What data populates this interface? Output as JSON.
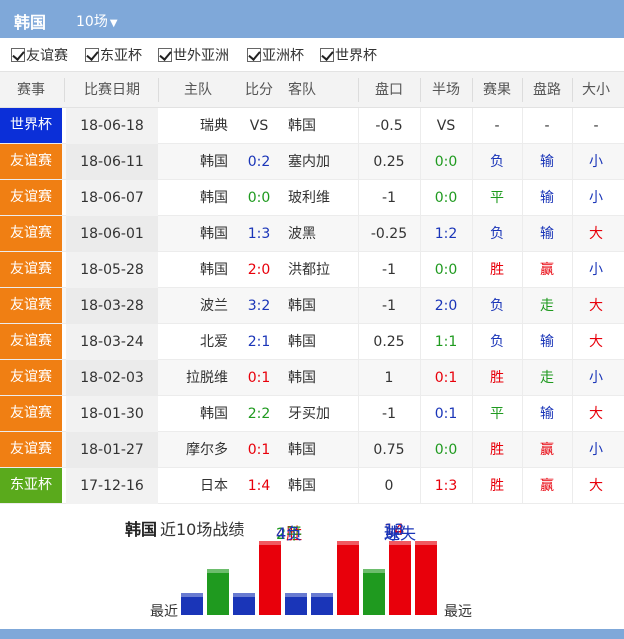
{
  "header": {
    "team": "韩国",
    "count_label": "10场"
  },
  "filters": [
    "友谊赛",
    "东亚杯",
    "世外亚洲",
    "亚洲杯",
    "世界杯"
  ],
  "columns": [
    "赛事",
    "比赛日期",
    "主队",
    "比分",
    "客队",
    "盘口",
    "半场",
    "赛果",
    "盘路",
    "大小"
  ],
  "colors": {
    "header": "#7fa8d9",
    "tag_world_cup": "#0b2fd8",
    "tag_friendly": "#f07f13",
    "tag_east_asian_cup": "#5aaa1c",
    "win": "#e8000b",
    "draw": "#1f9a1f",
    "loss": "#1a35b8"
  },
  "matches": [
    {
      "comp": "世界杯",
      "date": "18-06-18",
      "home": "瑞典",
      "score": "VS",
      "away": "韩国",
      "handicap": "-0.5",
      "half": "VS",
      "result": "-",
      "pan": "-",
      "ou": "-"
    },
    {
      "comp": "友谊赛",
      "date": "18-06-11",
      "home": "韩国",
      "score": "0:2",
      "away": "塞内加",
      "handicap": "0.25",
      "half": "0:0",
      "result": "负",
      "pan": "输",
      "ou": "小"
    },
    {
      "comp": "友谊赛",
      "date": "18-06-07",
      "home": "韩国",
      "score": "0:0",
      "away": "玻利维",
      "handicap": "-1",
      "half": "0:0",
      "result": "平",
      "pan": "输",
      "ou": "小"
    },
    {
      "comp": "友谊赛",
      "date": "18-06-01",
      "home": "韩国",
      "score": "1:3",
      "away": "波黑",
      "handicap": "-0.25",
      "half": "1:2",
      "result": "负",
      "pan": "输",
      "ou": "大"
    },
    {
      "comp": "友谊赛",
      "date": "18-05-28",
      "home": "韩国",
      "score": "2:0",
      "away": "洪都拉",
      "handicap": "-1",
      "half": "0:0",
      "result": "胜",
      "pan": "赢",
      "ou": "小"
    },
    {
      "comp": "友谊赛",
      "date": "18-03-28",
      "home": "波兰",
      "score": "3:2",
      "away": "韩国",
      "handicap": "-1",
      "half": "2:0",
      "result": "负",
      "pan": "走",
      "ou": "大"
    },
    {
      "comp": "友谊赛",
      "date": "18-03-24",
      "home": "北爱",
      "score": "2:1",
      "away": "韩国",
      "handicap": "0.25",
      "half": "1:1",
      "result": "负",
      "pan": "输",
      "ou": "大"
    },
    {
      "comp": "友谊赛",
      "date": "18-02-03",
      "home": "拉脱维",
      "score": "0:1",
      "away": "韩国",
      "handicap": "1",
      "half": "0:1",
      "result": "胜",
      "pan": "走",
      "ou": "小"
    },
    {
      "comp": "友谊赛",
      "date": "18-01-30",
      "home": "韩国",
      "score": "2:2",
      "away": "牙买加",
      "handicap": "-1",
      "half": "0:1",
      "result": "平",
      "pan": "输",
      "ou": "大"
    },
    {
      "comp": "友谊赛",
      "date": "18-01-27",
      "home": "摩尔多",
      "score": "0:1",
      "away": "韩国",
      "handicap": "0.75",
      "half": "0:0",
      "result": "胜",
      "pan": "赢",
      "ou": "小"
    },
    {
      "comp": "东亚杯",
      "date": "17-12-16",
      "home": "日本",
      "score": "1:4",
      "away": "韩国",
      "handicap": "0",
      "half": "1:3",
      "result": "胜",
      "pan": "赢",
      "ou": "大"
    }
  ],
  "summary": {
    "team": "韩国",
    "label": "近10场战绩",
    "record": [
      "4胜",
      "2平",
      "4负"
    ],
    "goals_for_label": "进",
    "goals_for": "14",
    "goals_against_label": "球失",
    "goals_against": "13",
    "goals_unit": "球"
  },
  "form_chart": {
    "left_label": "最近",
    "right_label": "最远",
    "results": [
      "负",
      "平",
      "负",
      "胜",
      "负",
      "负",
      "胜",
      "平",
      "胜",
      "胜"
    ]
  }
}
